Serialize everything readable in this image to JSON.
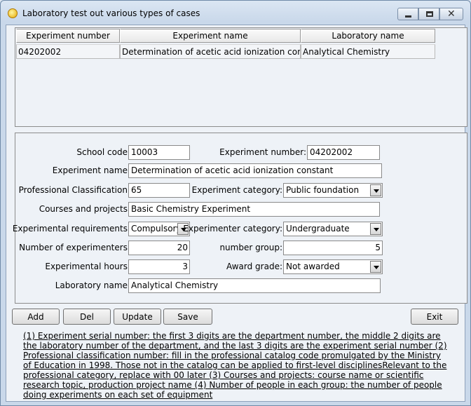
{
  "window": {
    "title": "Laboratory test out various types of cases"
  },
  "table": {
    "columns": [
      "Experiment number",
      "Experiment name",
      "Laboratory name"
    ],
    "rows": [
      [
        "04202002",
        "Determination of acetic acid ionization constant",
        "Analytical Chemistry"
      ]
    ]
  },
  "form": {
    "school_code": {
      "label": "School code:",
      "value": "10003"
    },
    "experiment_number": {
      "label": "Experiment number:",
      "value": "04202002"
    },
    "experiment_name": {
      "label": "Experiment name:",
      "value": "Determination of acetic acid ionization constant"
    },
    "professional_classification": {
      "label": "Professional Classification:",
      "value": "65"
    },
    "experiment_category": {
      "label": "Experiment category:",
      "value": "Public foundation"
    },
    "courses_projects": {
      "label": "Courses and projects:",
      "value": "Basic Chemistry Experiment"
    },
    "experimental_requirements": {
      "label": "Experimental requirements:",
      "value": "Compulsory"
    },
    "experimenter_category": {
      "label": "Experimenter category:",
      "value": "Undergraduate"
    },
    "number_of_experimenters": {
      "label": "Number of experimenters:",
      "value": "20"
    },
    "number_group": {
      "label": "number group:",
      "value": "5"
    },
    "experimental_hours": {
      "label": "Experimental hours:",
      "value": "3"
    },
    "award_grade": {
      "label": "Award grade:",
      "value": "Not awarded"
    },
    "laboratory_name": {
      "label": "Laboratory name:",
      "value": "Analytical Chemistry"
    }
  },
  "buttons": {
    "add": "Add",
    "del": "Del",
    "update": "Update",
    "save": "Save",
    "exit": "Exit"
  },
  "notes": "(1) Experiment serial number: the first 3 digits are the department number, the middle 2 digits are the laboratory number of the department, and the last 3 digits are the experiment serial number (2) Professional classification number: fill in the professional catalog code promulgated by the Ministry of Education in 1998. Those not in the catalog can be applied to first-level disciplinesRelevant to the professional category, replace with 00 later (3) Courses and projects: course name or scientific research topic, production project name (4) Number of people in each group: the number of people doing experiments on each set of equipment"
}
